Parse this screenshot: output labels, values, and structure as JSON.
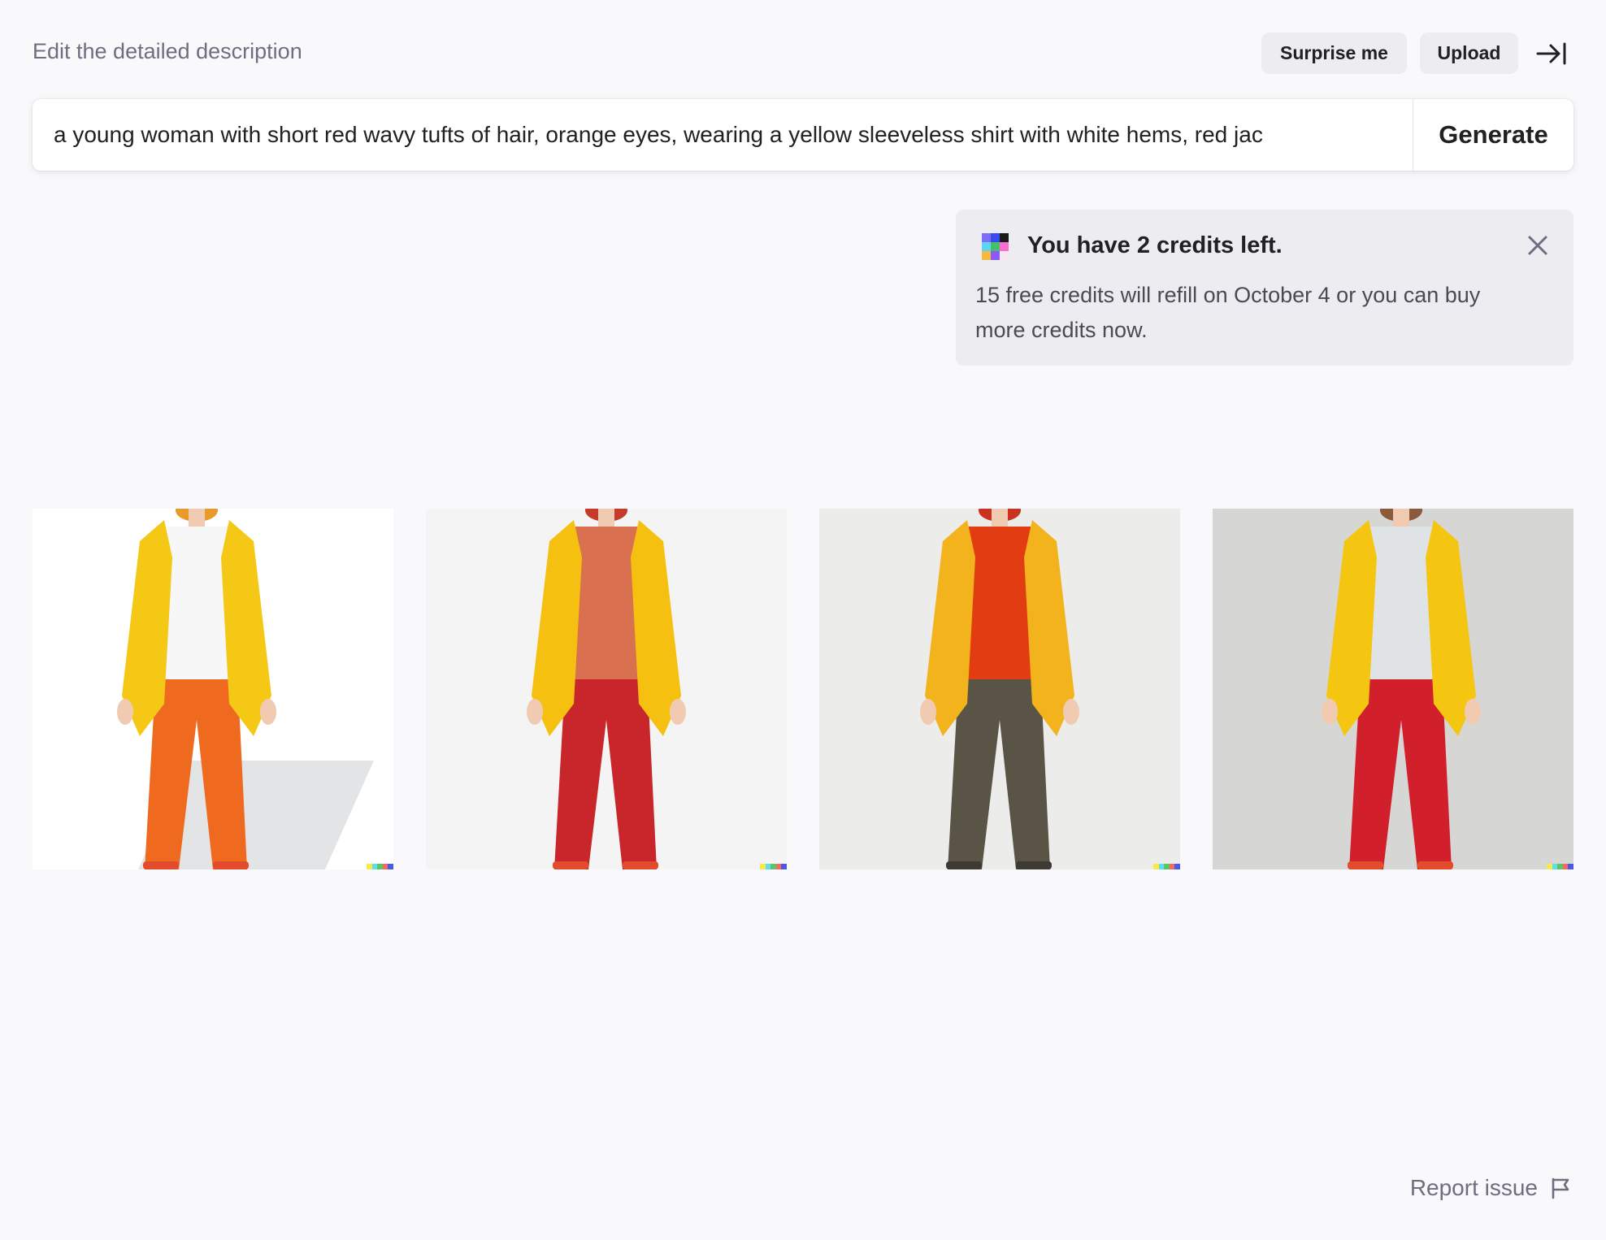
{
  "header": {
    "label": "Edit the detailed description",
    "surprise_label": "Surprise me",
    "upload_label": "Upload",
    "collapse_icon": "collapse-right-icon"
  },
  "prompt": {
    "value": "a young woman with short red wavy tufts of hair, orange eyes, wearing a yellow sleeveless shirt with white hems, red jac",
    "generate_label": "Generate"
  },
  "notice": {
    "logo_icon": "dalle-logo-icon",
    "title": "You have 2 credits left.",
    "body": "15 free credits will refill on October 4 or you can buy more credits now.",
    "close_icon": "close-icon",
    "logo_colors": [
      "#7c6cf6",
      "#3b49f0",
      "#1a1a1a",
      "#5fd3f3",
      "#44c06b",
      "#f76ed1",
      "#f5b942",
      "#8a5cf5",
      "#f5e8f3"
    ]
  },
  "images": [
    {
      "name": "generated-image-1",
      "background": "#ffffff",
      "jacket": "#f4c814",
      "shirt": "#f7f7f7",
      "pants": "#ef6a1f",
      "hair": "#e89a2a"
    },
    {
      "name": "generated-image-2",
      "background": "#f4f4f4",
      "jacket": "#f5c010",
      "shirt": "#d9704f",
      "pants": "#c8262a",
      "hair": "#c53b2a"
    },
    {
      "name": "generated-image-3",
      "background": "#ececea",
      "jacket": "#f3b31c",
      "shirt": "#e23d12",
      "pants": "#5a5446",
      "hair": "#c93320"
    },
    {
      "name": "generated-image-4",
      "background": "#d6d6d4",
      "jacket": "#f4c612",
      "shirt": "#dfe3e6",
      "pants": "#d21f2c",
      "hair": "#8a5a3a"
    }
  ],
  "signature_colors": [
    "#f7e94a",
    "#5fe0e6",
    "#57c76a",
    "#f56a5a",
    "#4a59e8"
  ],
  "footer": {
    "report_label": "Report issue",
    "report_icon": "flag-icon"
  }
}
